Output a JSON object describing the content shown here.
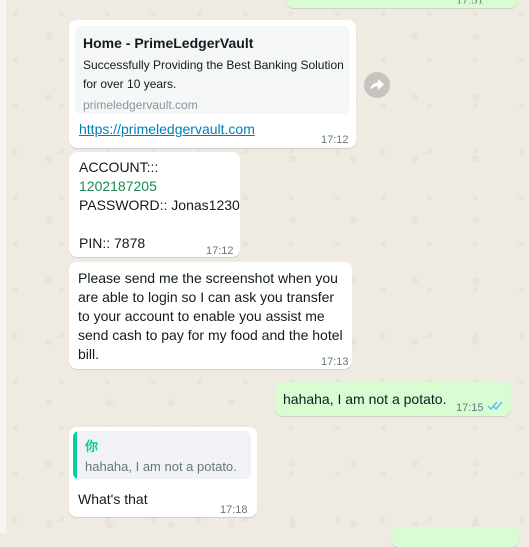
{
  "messages": {
    "top_partial": {
      "time": "17:51"
    },
    "link_message": {
      "preview_title": "Home - PrimeLedgerVault",
      "preview_description": "Successfully Providing the Best Banking Solution for over 10 years.",
      "preview_domain": "primeledgervault.com",
      "link_text": "https://primeledgervault.com",
      "time": "17:12"
    },
    "account_message": {
      "account_label": "ACCOUNT::: ",
      "account_number": "1202187205",
      "password_line": "PASSWORD:: Jonas1230",
      "pin_line": "PIN:: 7878",
      "time": "17:12"
    },
    "request_message": {
      "text": "Please send me the screenshot when you are able to login so I can ask you transfer to your account to enable you assist me send cash to pay for my food and the hotel bill.",
      "time": "17:13"
    },
    "potato_message": {
      "text": "hahaha, I am not a potato.",
      "time": "17:15"
    },
    "reply_message": {
      "quoted_author": "你",
      "quoted_text": "hahaha, I am not a potato.",
      "text": "What's that",
      "time": "17:18"
    }
  },
  "colors": {
    "incoming_bubble": "#ffffff",
    "outgoing_bubble": "#d9fdd3",
    "read_ticks": "#53bdeb",
    "quote_accent": "#06cf9c",
    "link": "#027eb5"
  },
  "icons": [
    "forward-icon",
    "double-check-icon"
  ]
}
